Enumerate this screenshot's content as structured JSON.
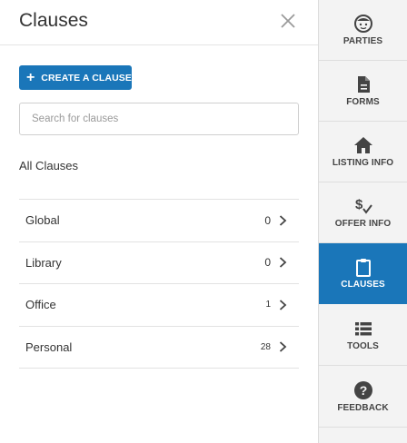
{
  "panel": {
    "title": "Clauses",
    "create_button_label": "CREATE A CLAUSE",
    "search_placeholder": "Search for clauses",
    "section_label": "All Clauses",
    "clauses": [
      {
        "name": "Global",
        "count": "0"
      },
      {
        "name": "Library",
        "count": "0"
      },
      {
        "name": "Office",
        "count": "1"
      },
      {
        "name": "Personal",
        "count": "28"
      }
    ]
  },
  "sidebar": {
    "items": [
      {
        "label": "PARTIES",
        "icon": "face-icon"
      },
      {
        "label": "FORMS",
        "icon": "document-icon"
      },
      {
        "label": "LISTING INFO",
        "icon": "home-icon"
      },
      {
        "label": "OFFER INFO",
        "icon": "dollar-check-icon"
      },
      {
        "label": "CLAUSES",
        "icon": "clipboard-icon",
        "active": true
      },
      {
        "label": "TOOLS",
        "icon": "list-icon"
      },
      {
        "label": "FEEDBACK",
        "icon": "help-icon"
      }
    ]
  },
  "colors": {
    "accent": "#1a76b9",
    "sidebar_bg": "#f3f3f3",
    "text": "#333333"
  }
}
